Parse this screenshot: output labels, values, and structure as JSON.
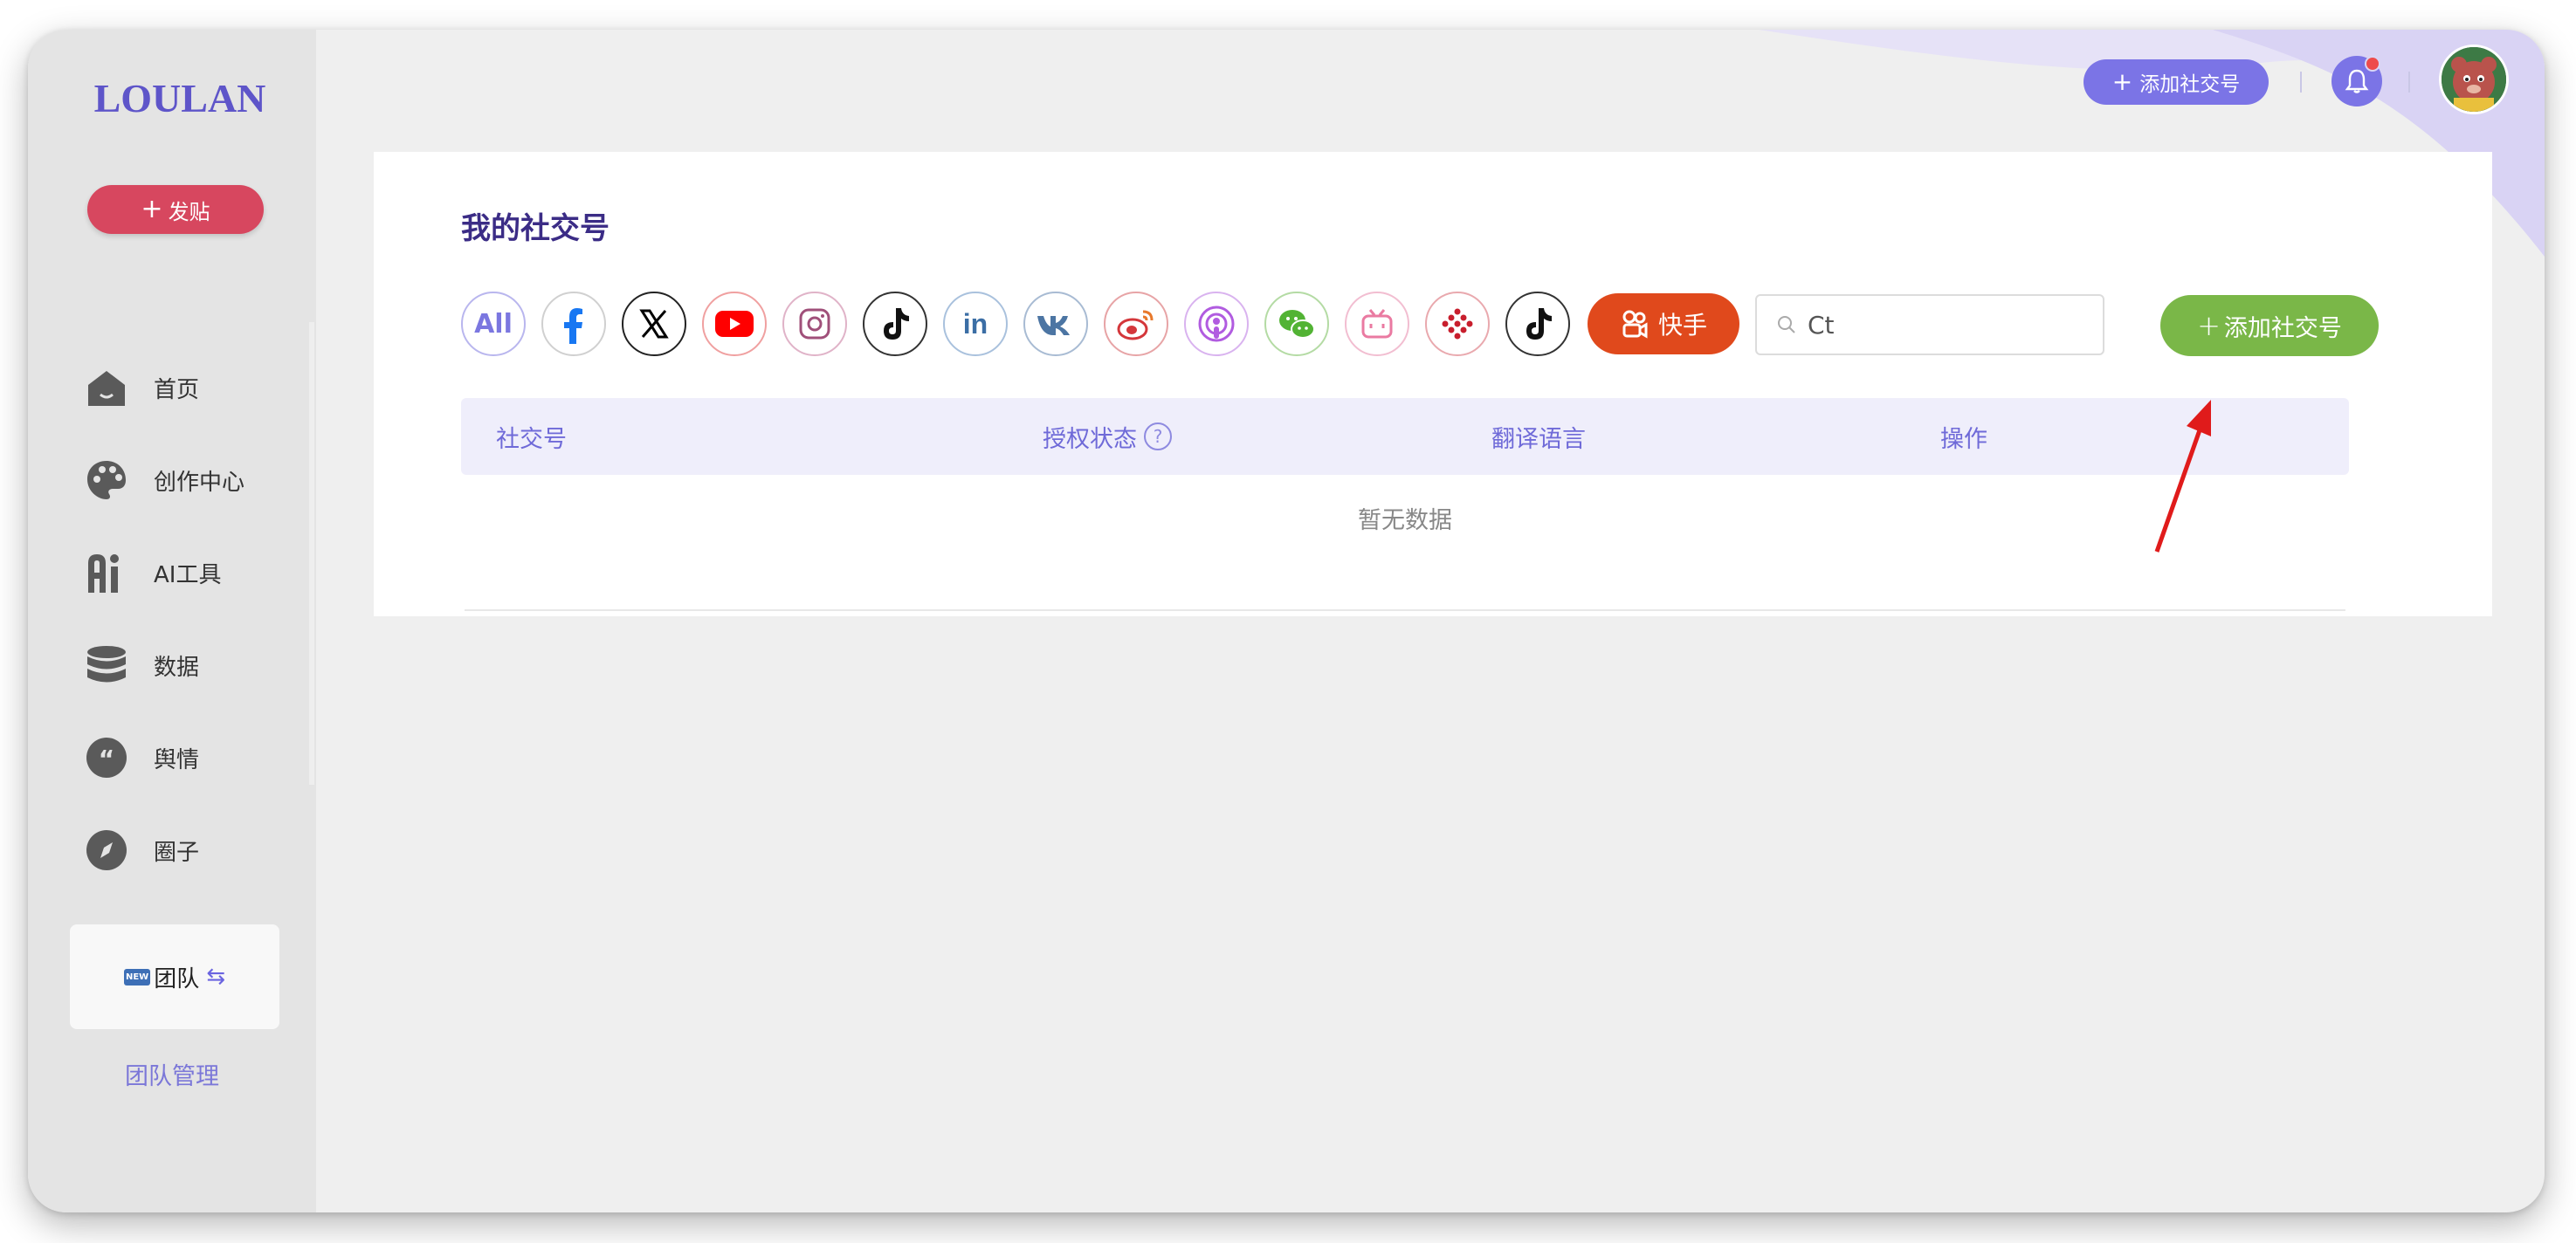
{
  "app": {
    "logo": "LOULAN"
  },
  "sidebar": {
    "post_button": "发贴",
    "items": [
      {
        "label": "首页",
        "icon": "home-icon"
      },
      {
        "label": "创作中心",
        "icon": "palette-icon"
      },
      {
        "label": "AI工具",
        "icon": "ai-icon"
      },
      {
        "label": "数据",
        "icon": "database-icon"
      },
      {
        "label": "舆情",
        "icon": "quote-icon"
      },
      {
        "label": "圈子",
        "icon": "compass-icon"
      }
    ],
    "team_card": {
      "badge": "NEW",
      "label": "团队"
    },
    "team_manage": "团队管理"
  },
  "header": {
    "add_account_label": "添加社交号"
  },
  "main": {
    "title": "我的社交号",
    "platforms": [
      {
        "name": "All",
        "label": "All",
        "color": "#6f6ad8"
      },
      {
        "name": "facebook",
        "color": "#1877f2"
      },
      {
        "name": "x",
        "color": "#000000"
      },
      {
        "name": "youtube",
        "color": "#ff0000"
      },
      {
        "name": "instagram",
        "color": "#a0507a"
      },
      {
        "name": "tiktok",
        "color": "#000000"
      },
      {
        "name": "linkedin",
        "color": "#3b6ea5"
      },
      {
        "name": "vk",
        "color": "#4c75a3"
      },
      {
        "name": "weibo",
        "color": "#d4373b"
      },
      {
        "name": "podcasts",
        "color": "#b15ce0"
      },
      {
        "name": "wechat",
        "color": "#52b334"
      },
      {
        "name": "bilibili",
        "color": "#ea7aa1"
      },
      {
        "name": "dots",
        "color": "#c81e2d"
      },
      {
        "name": "douyin",
        "color": "#000000"
      }
    ],
    "kuaishou_label": "快手",
    "search": {
      "value": "Ct"
    },
    "add_button_label": "添加社交号",
    "table": {
      "columns": [
        "社交号",
        "授权状态",
        "翻译语言",
        "操作"
      ],
      "help": "?",
      "empty_text": "暂无数据"
    }
  },
  "colors": {
    "accent": "#7b74e6",
    "post_button": "#d7475f",
    "add_button": "#7ab748",
    "kuaishou": "#e0491c"
  }
}
